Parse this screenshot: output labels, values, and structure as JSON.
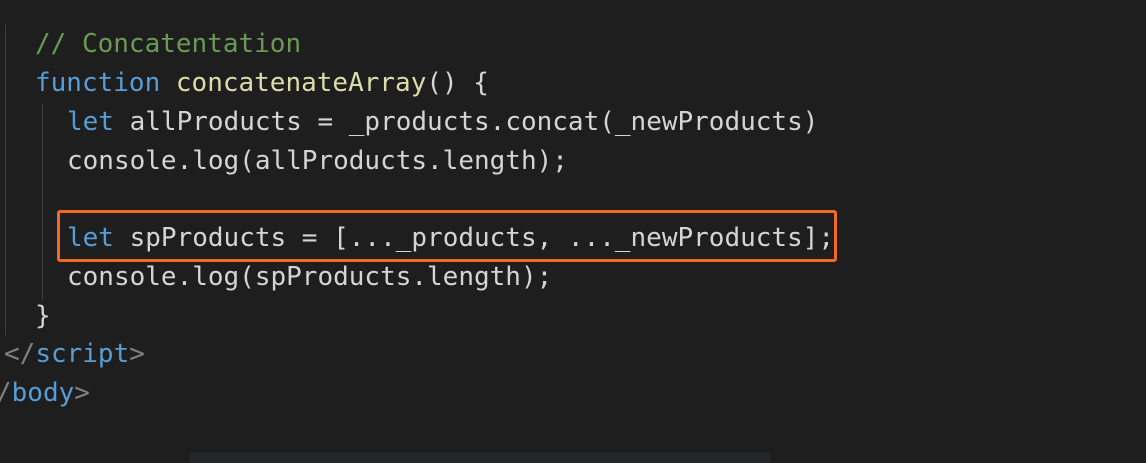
{
  "editor": {
    "background": "#1e1e1e",
    "lines": [
      {
        "tokens": [
          {
            "t": "// Concatentation",
            "c": "comment"
          }
        ]
      },
      {
        "tokens": [
          {
            "t": "function",
            "c": "keyword"
          },
          {
            "t": " ",
            "c": "punct"
          },
          {
            "t": "concatenateArray",
            "c": "func"
          },
          {
            "t": "() {",
            "c": "punct"
          }
        ]
      },
      {
        "tokens": [
          {
            "t": "let",
            "c": "keyword"
          },
          {
            "t": " allProducts = _products.",
            "c": "punct"
          },
          {
            "t": "concat",
            "c": "punct"
          },
          {
            "t": "(_newProducts)",
            "c": "punct"
          }
        ]
      },
      {
        "tokens": [
          {
            "t": "console.log(allProducts.length);",
            "c": "punct"
          }
        ]
      },
      {
        "tokens": []
      },
      {
        "tokens": [
          {
            "t": "let",
            "c": "keyword"
          },
          {
            "t": " spProducts = [..._products, ..._newProducts];",
            "c": "punct"
          }
        ]
      },
      {
        "tokens": [
          {
            "t": "console.log(spProducts.length);",
            "c": "punct"
          }
        ]
      },
      {
        "tokens": [
          {
            "t": "}",
            "c": "punct"
          }
        ]
      },
      {
        "tokens": [
          {
            "t": "</",
            "c": "tagpunct"
          },
          {
            "t": "script",
            "c": "tag"
          },
          {
            "t": ">",
            "c": "tagpunct"
          }
        ]
      },
      {
        "tokens": [
          {
            "t": "/",
            "c": "tagpunct"
          },
          {
            "t": "body",
            "c": "tag"
          },
          {
            "t": ">",
            "c": "tagpunct"
          }
        ]
      }
    ]
  },
  "highlight": {
    "color": "#f26a21",
    "target_line": 5
  },
  "colors": {
    "comment": "#6a9955",
    "keyword": "#569cd6",
    "func": "#dcdcaa",
    "var": "#9cdcfe",
    "punct": "#d4d4d4",
    "tag": "#569cd6",
    "tagpunct": "#808080"
  }
}
